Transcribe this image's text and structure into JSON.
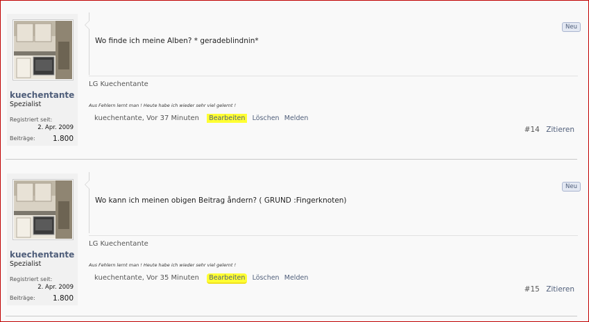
{
  "posts": [
    {
      "badge": "Neu",
      "username": "kuechentante",
      "rank": "Spezialist",
      "registered_label": "Registriert seit:",
      "registered_value": "2. Apr. 2009",
      "posts_label": "Beiträge:",
      "posts_value": "1.800",
      "message": "Wo finde ich meine Alben? * geradeblindnin*",
      "signature": "LG Kuechentante",
      "quote": "Aus Fehlern lernt man ! Heute habe ich wieder sehr viel gelernt !",
      "author_time": "kuechentante, Vor 37 Minuten",
      "edit_label": "Bearbeiten",
      "delete_label": "Löschen",
      "report_label": "Melden",
      "post_number": "#14",
      "quote_label": "Zitieren"
    },
    {
      "badge": "Neu",
      "username": "kuechentante",
      "rank": "Spezialist",
      "registered_label": "Registriert seit:",
      "registered_value": "2. Apr. 2009",
      "posts_label": "Beiträge:",
      "posts_value": "1.800",
      "message": "Wo kann ich meinen obigen Beitrag åndern? ( GRUND :Fingerknoten)",
      "signature": "LG Kuechentante",
      "quote": "Aus Fehlern lernt man ! Heute habe ich wieder sehr viel gelernt !",
      "author_time": "kuechentante, Vor 35 Minuten",
      "edit_label": "Bearbeiten",
      "delete_label": "Löschen",
      "report_label": "Melden",
      "post_number": "#15",
      "quote_label": "Zitieren"
    }
  ],
  "colors": {
    "highlight": "#ffff33",
    "link": "#4f5e7a",
    "frame_border": "#c00000"
  },
  "icons": {
    "avatar": "kitchen-photo"
  }
}
